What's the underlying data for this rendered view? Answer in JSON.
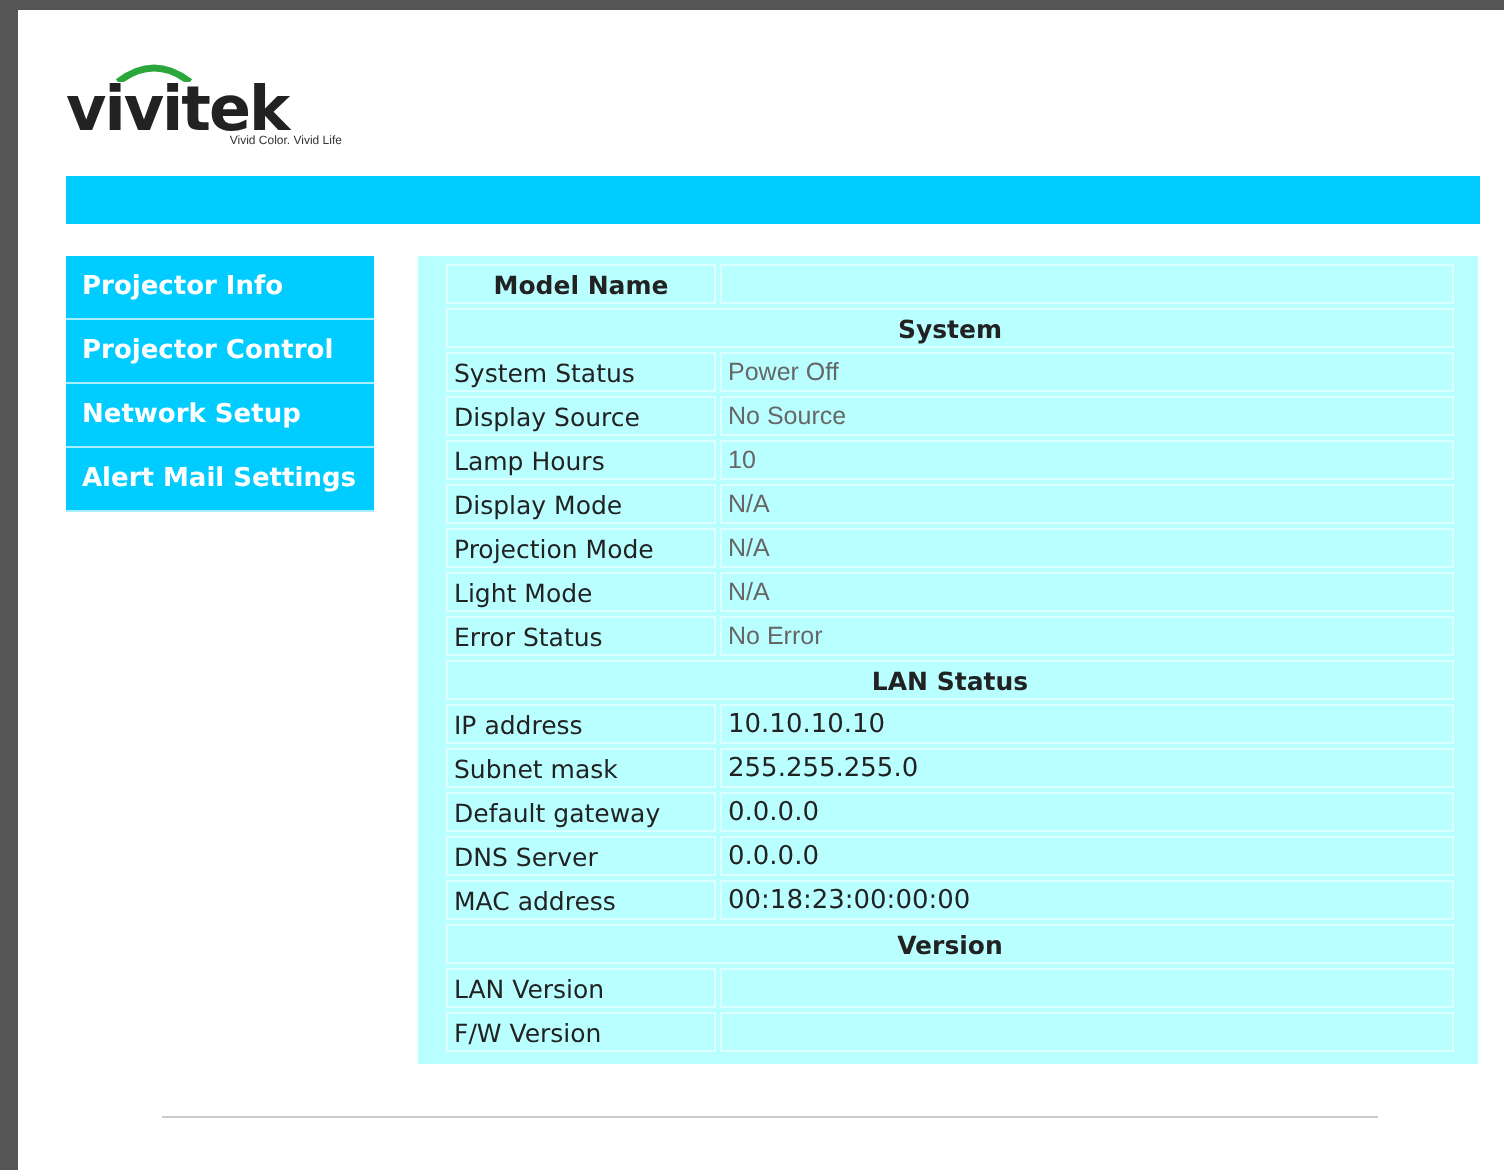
{
  "logo": {
    "name": "vivitek",
    "tagline": "Vivid Color. Vivid Life"
  },
  "nav": [
    {
      "label": "Projector Info"
    },
    {
      "label": "Projector Control"
    },
    {
      "label": "Network Setup"
    },
    {
      "label": "Alert Mail Settings"
    }
  ],
  "table": {
    "rows": [
      {
        "kind": "title",
        "label": "Model Name",
        "value": ""
      },
      {
        "kind": "section",
        "label": "System"
      },
      {
        "kind": "status",
        "label": "System Status",
        "value": "Power Off"
      },
      {
        "kind": "status",
        "label": "Display Source",
        "value": "No Source"
      },
      {
        "kind": "status",
        "label": "Lamp Hours",
        "value": "10"
      },
      {
        "kind": "status",
        "label": "Display Mode",
        "value": "N/A"
      },
      {
        "kind": "status",
        "label": "Projection Mode",
        "value": "N/A"
      },
      {
        "kind": "status",
        "label": "Light Mode",
        "value": "N/A"
      },
      {
        "kind": "status",
        "label": "Error Status",
        "value": "No Error"
      },
      {
        "kind": "section",
        "label": "LAN Status"
      },
      {
        "kind": "info",
        "label": "IP address",
        "value": "10.10.10.10"
      },
      {
        "kind": "info",
        "label": "Subnet mask",
        "value": "255.255.255.0"
      },
      {
        "kind": "info",
        "label": "Default gateway",
        "value": "0.0.0.0"
      },
      {
        "kind": "info",
        "label": "DNS Server",
        "value": "0.0.0.0"
      },
      {
        "kind": "info",
        "label": "MAC address",
        "value": "00:18:23:00:00:00"
      },
      {
        "kind": "section",
        "label": "Version"
      },
      {
        "kind": "info",
        "label": "LAN Version",
        "value": ""
      },
      {
        "kind": "info",
        "label": "F/W Version",
        "value": ""
      }
    ]
  }
}
